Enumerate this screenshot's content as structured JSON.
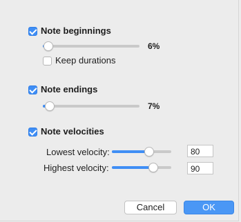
{
  "note_beginnings": {
    "label": "Note beginnings",
    "checked": true,
    "slider_value": 0.06,
    "value_text": "6%",
    "keep_durations": {
      "label": "Keep durations",
      "checked": false
    }
  },
  "note_endings": {
    "label": "Note endings",
    "checked": true,
    "slider_value": 0.07,
    "value_text": "7%"
  },
  "note_velocities": {
    "label": "Note velocities",
    "checked": true,
    "lowest": {
      "label": "Lowest velocity:",
      "slider_value": 0.63,
      "value": "80"
    },
    "highest": {
      "label": "Highest velocity:",
      "slider_value": 0.7,
      "value": "90"
    }
  },
  "buttons": {
    "cancel": "Cancel",
    "ok": "OK"
  },
  "colors": {
    "accent": "#3f8ef5",
    "track": "#c9c9c9",
    "background": "#ececec"
  }
}
